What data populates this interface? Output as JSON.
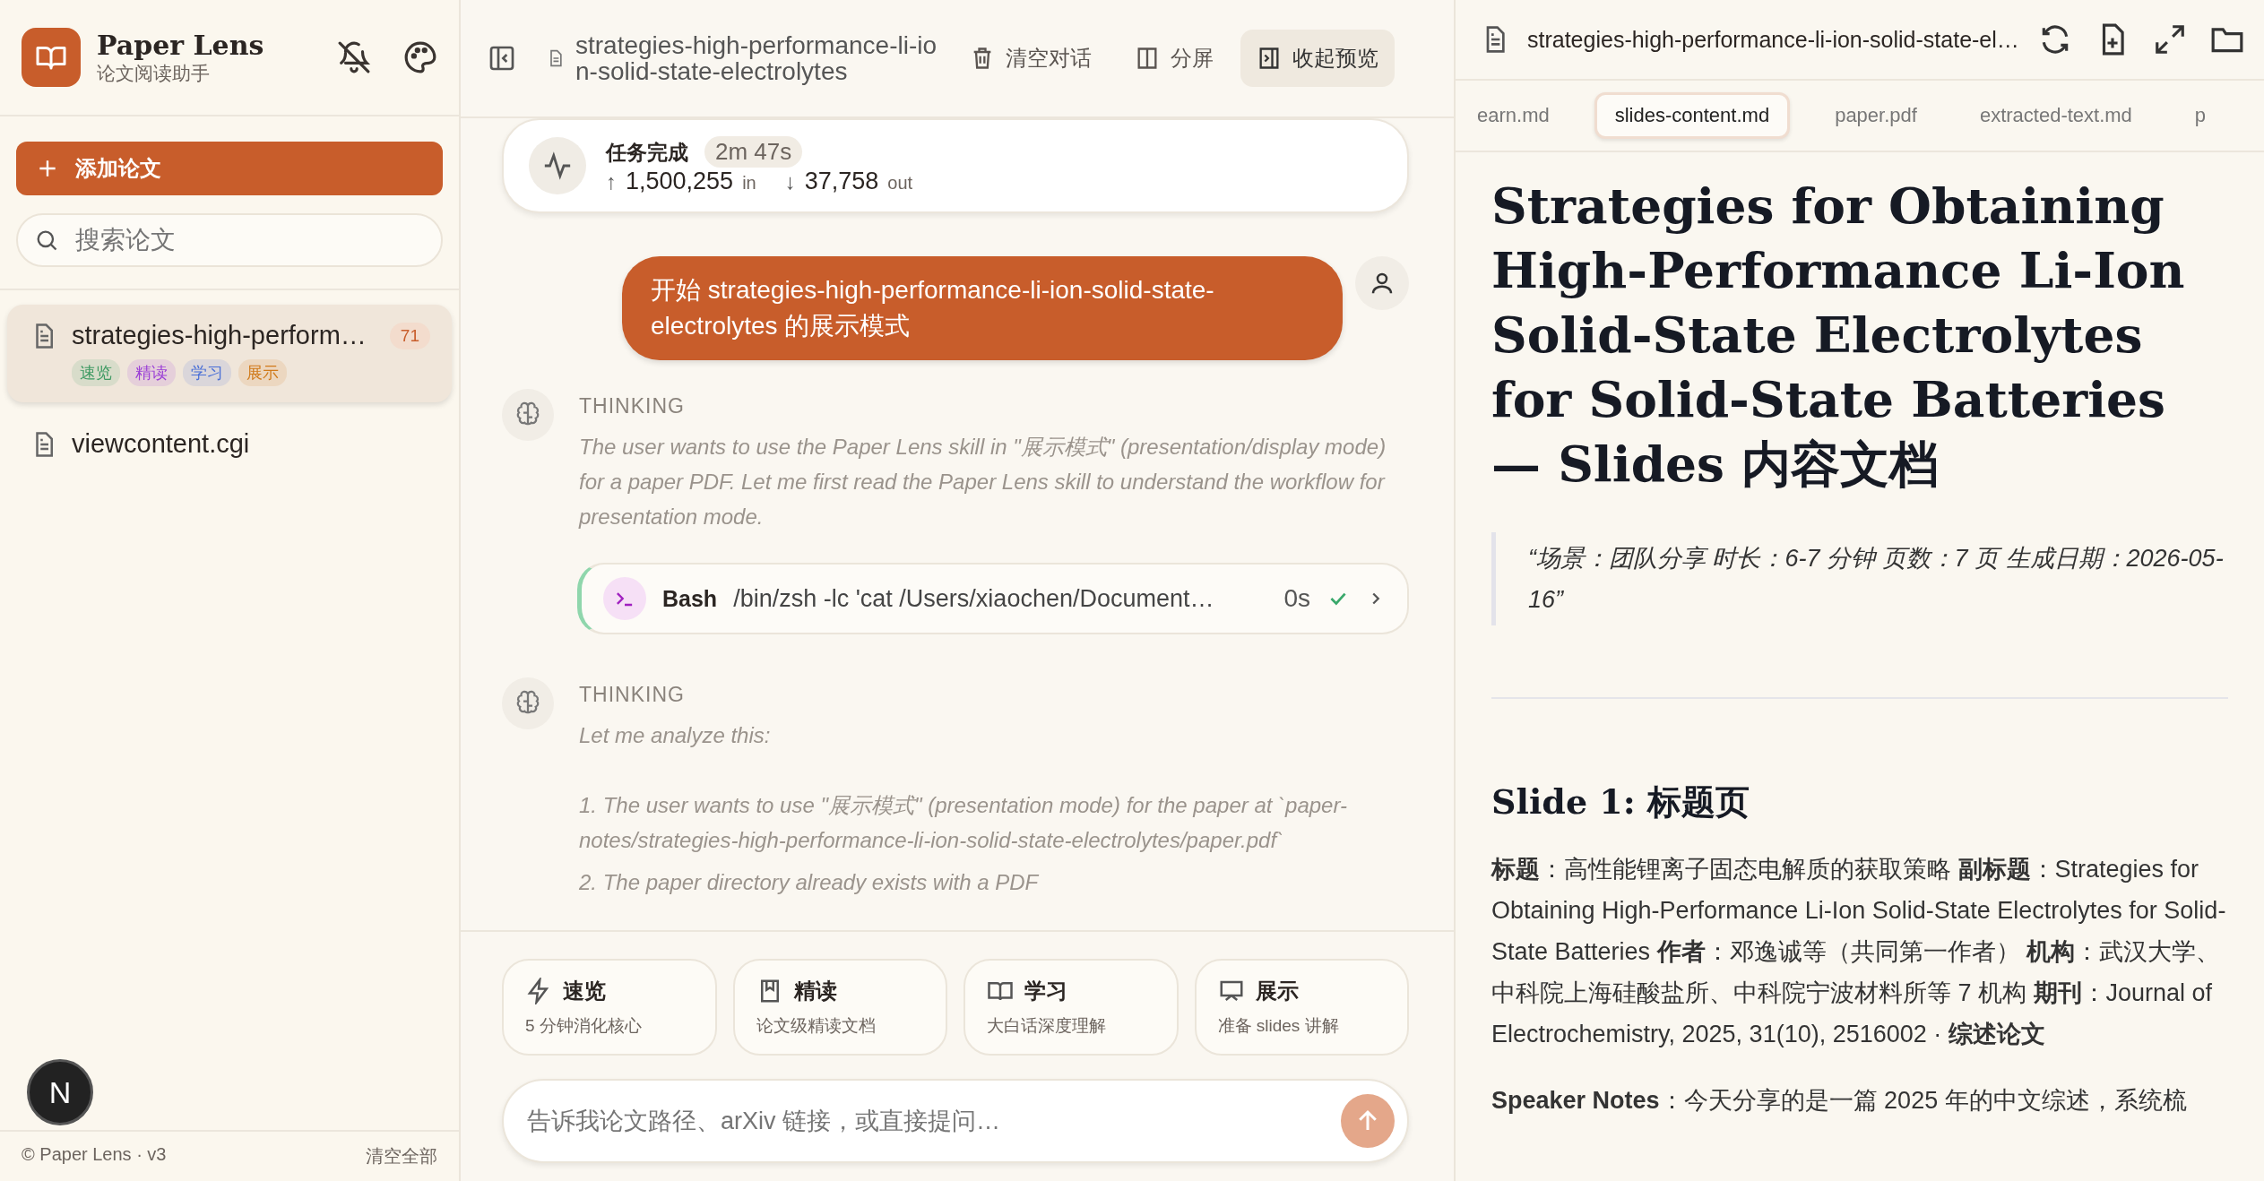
{
  "sidebar": {
    "app_name": "Paper Lens",
    "app_subtitle": "论文阅读助手",
    "add_button": "添加论文",
    "search": {
      "placeholder": "搜索论文"
    },
    "papers": [
      {
        "name": "strategies-high-perform…",
        "count": "71",
        "selected": true,
        "tags": [
          {
            "label": "速览",
            "color": "#3f9a63"
          },
          {
            "label": "精读",
            "color": "#9b3fd6"
          },
          {
            "label": "学习",
            "color": "#4a6fd6"
          },
          {
            "label": "展示",
            "color": "#d07a1a"
          }
        ]
      },
      {
        "name": "viewcontent.cgi",
        "selected": false
      }
    ],
    "dev_badge": "N",
    "footer": "© Paper Lens · v3",
    "clear_all": "清空全部"
  },
  "chat": {
    "title": "strategies-high-performance-li-ion-solid-state-electrolytes",
    "actions": [
      {
        "label": "清空对话",
        "kind": "trash",
        "selected": false
      },
      {
        "label": "分屏",
        "kind": "split",
        "selected": false
      },
      {
        "label": "收起预览",
        "kind": "collapse",
        "selected": true
      }
    ],
    "status": {
      "title": "任务完成",
      "duration": "2m 47s",
      "in_arrow": "↑",
      "in_count": "1,500,255",
      "in_unit": "in",
      "out_arrow": "↓",
      "out_count": "37,758",
      "out_unit": "out"
    },
    "messages": [
      {
        "kind": "user",
        "text": "开始 strategies-high-performance-li-ion-solid-state-electrolytes 的展示模式"
      },
      {
        "kind": "thinking",
        "label": "THINKING",
        "lines": [
          "The user wants to use the Paper Lens skill in \"展示模式\" (presentation/display mode) for a paper PDF. Let me first read the Paper Lens skill to understand the workflow for presentation mode."
        ]
      },
      {
        "kind": "tool",
        "name": "Bash",
        "command": "/bin/zsh -lc 'cat /Users/xiaochen/Document…",
        "duration": "0s",
        "done": true
      },
      {
        "kind": "thinking",
        "label": "THINKING",
        "lines": [
          "Let me analyze this:",
          "1. The user wants to use \"展示模式\" (presentation mode) for the paper at `paper-notes/strategies-high-performance-li-ion-solid-state-electrolytes/paper.pdf`",
          "2. The paper directory already exists with a PDF"
        ]
      }
    ],
    "modes": [
      {
        "kind": "bolt",
        "title": "速览",
        "desc": "5 分钟消化核心"
      },
      {
        "kind": "bookmark",
        "title": "精读",
        "desc": "论文级精读文档"
      },
      {
        "kind": "book",
        "title": "学习",
        "desc": "大白话深度理解"
      },
      {
        "kind": "screen",
        "title": "展示",
        "desc": "准备 slides 讲解"
      }
    ],
    "input": {
      "placeholder": "告诉我论文路径、arXiv 链接，或直接提问…"
    }
  },
  "preview": {
    "file": "strategies-high-performance-li-ion-solid-state-el…",
    "tabs": [
      {
        "label": "earn.md",
        "selected": false
      },
      {
        "label": "slides-content.md",
        "selected": true
      },
      {
        "label": "paper.pdf",
        "selected": false
      },
      {
        "label": "extracted-text.md",
        "selected": false
      },
      {
        "label": "p",
        "selected": false
      }
    ],
    "heading": "Strategies for Obtaining High-Performance Li-Ion Solid-State Electrolytes for Solid-State Batteries — Slides 内容文档",
    "quote": "“场景：团队分享 时长：6-7 分钟 页数：7 页 生成日期：2026-05-16”",
    "slide_heading": "Slide 1: 标题页",
    "paragraphs": [
      "**标题**：高性能锂离子固态电解质的获取策略 **副标题**：Strategies for Obtaining High-Performance Li-Ion Solid-State Electrolytes for Solid-State Batteries **作者**：邓逸诚等（共同第一作者） **机构**：武汉大学、中科院上海硅酸盐所、中科院宁波材料所等 7 机构 **期刊**：Journal of Electrochemistry, 2025, 31(10), 2516002 · **综述论文**",
      "**Speaker Notes**：今天分享的是一篇 2025 年的中文综述，系统梳"
    ]
  }
}
